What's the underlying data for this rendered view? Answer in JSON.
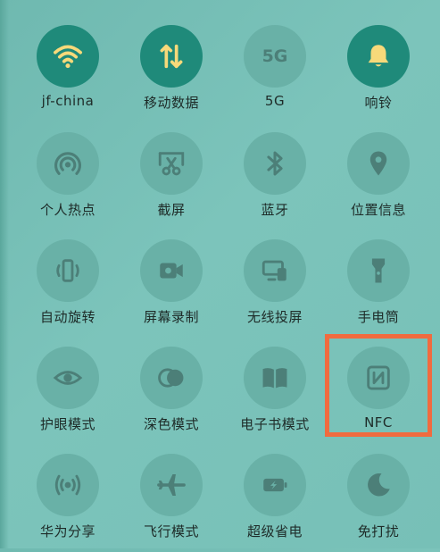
{
  "colors": {
    "tile": "#69b1a7",
    "tile_active": "#1f8a7a",
    "icon": "#4c7f78",
    "icon_active": "#f7d97a",
    "highlight": "#f06b3f"
  },
  "tiles": [
    {
      "label": "jf-china",
      "icon": "wifi-icon",
      "active": true
    },
    {
      "label": "移动数据",
      "icon": "mobile-data-icon",
      "active": true
    },
    {
      "label": "5G",
      "icon": "5g-icon",
      "badge": "5G",
      "active": false
    },
    {
      "label": "响铃",
      "icon": "bell-icon",
      "active": true
    },
    {
      "label": "个人热点",
      "icon": "hotspot-icon",
      "active": false
    },
    {
      "label": "截屏",
      "icon": "screenshot-icon",
      "active": false
    },
    {
      "label": "蓝牙",
      "icon": "bluetooth-icon",
      "active": false
    },
    {
      "label": "位置信息",
      "icon": "location-icon",
      "active": false
    },
    {
      "label": "自动旋转",
      "icon": "rotate-icon",
      "active": false
    },
    {
      "label": "屏幕录制",
      "icon": "screen-record-icon",
      "active": false
    },
    {
      "label": "无线投屏",
      "icon": "cast-icon",
      "active": false
    },
    {
      "label": "手电筒",
      "icon": "flashlight-icon",
      "active": false
    },
    {
      "label": "护眼模式",
      "icon": "eye-icon",
      "active": false
    },
    {
      "label": "深色模式",
      "icon": "dark-mode-icon",
      "active": false
    },
    {
      "label": "电子书模式",
      "icon": "ebook-icon",
      "active": false
    },
    {
      "label": "NFC",
      "icon": "nfc-icon",
      "active": false,
      "highlighted": true
    },
    {
      "label": "华为分享",
      "icon": "share-icon",
      "active": false
    },
    {
      "label": "飞行模式",
      "icon": "airplane-icon",
      "active": false
    },
    {
      "label": "超级省电",
      "icon": "battery-saver-icon",
      "active": false
    },
    {
      "label": "免打扰",
      "icon": "moon-icon",
      "active": false
    }
  ]
}
